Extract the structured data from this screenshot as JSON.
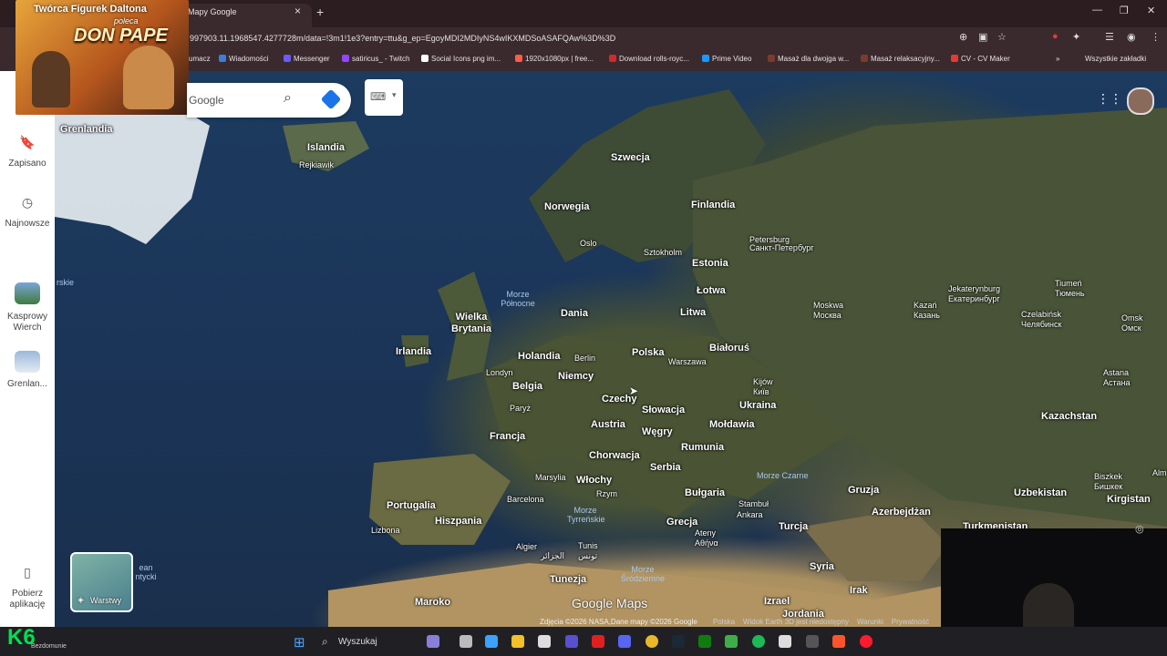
{
  "browser": {
    "tab_title": "Mapy Google",
    "tab_close": "×",
    "new_tab": "+",
    "url": "997903.11.1968547.4277728m/data=!3m1!1e3?entry=ttu&g_ep=EgoyMDI2MDIyNS4wIKXMDSoASAFQAw%3D%3D",
    "window_controls": [
      "—",
      "❐",
      "✕"
    ],
    "address_icons": [
      "zoom-icon",
      "install-icon",
      "star-icon",
      "extension-icon",
      "menu-icon"
    ],
    "bookmarks": [
      {
        "label": "umacz",
        "color": "#3b7ddd"
      },
      {
        "label": "Wiadomości",
        "color": "#3b7ddd"
      },
      {
        "label": "Messenger",
        "color": "#6a5cf5"
      },
      {
        "label": "satiricus_ - Twitch",
        "color": "#9146ff"
      },
      {
        "label": "Social Icons png im...",
        "color": "#ffffff"
      },
      {
        "label": "1920x1080px | free...",
        "color": "#ff5a4a"
      },
      {
        "label": "Download rolls-royc...",
        "color": "#d12a2a"
      },
      {
        "label": "Prime Video",
        "color": "#1a98ff"
      },
      {
        "label": "Masaż dla dwojga w...",
        "color": "#7b3b2f"
      },
      {
        "label": "Masaż relaksacyjny...",
        "color": "#7b3b2f"
      },
      {
        "label": "CV - CV Maker",
        "color": "#e53935"
      }
    ],
    "bookmarks_more": "»",
    "all_bookmarks": "Wszystkie zakładki"
  },
  "promo": {
    "line1": "Twórca Figurek Daltona",
    "line2": "poleca",
    "line3": "DON PAPE"
  },
  "search": {
    "placeholder": "Google"
  },
  "sidebar": {
    "saved": "Zapisano",
    "recent": "Najnowsze",
    "place1": "Kasprowy Wierch",
    "place2": "Grenlan...",
    "get_app": "Pobierz aplikację"
  },
  "map": {
    "countries": [
      {
        "name": "Grenlandia"
      },
      {
        "name": "Islandia"
      },
      {
        "name": "Szwecja"
      },
      {
        "name": "Norwegia"
      },
      {
        "name": "Finlandia"
      },
      {
        "name": "Estonia"
      },
      {
        "name": "Łotwa"
      },
      {
        "name": "Litwa"
      },
      {
        "name": "Dania"
      },
      {
        "name": "Wielka Brytania"
      },
      {
        "name": "Irlandia"
      },
      {
        "name": "Holandia"
      },
      {
        "name": "Polska"
      },
      {
        "name": "Białoruś"
      },
      {
        "name": "Niemcy"
      },
      {
        "name": "Belgia"
      },
      {
        "name": "Czechy"
      },
      {
        "name": "Ukraina"
      },
      {
        "name": "Słowacja"
      },
      {
        "name": "Mołdawia"
      },
      {
        "name": "Austria"
      },
      {
        "name": "Węgry"
      },
      {
        "name": "Francja"
      },
      {
        "name": "Rumunia"
      },
      {
        "name": "Chorwacja"
      },
      {
        "name": "Serbia"
      },
      {
        "name": "Włochy"
      },
      {
        "name": "Bułgaria"
      },
      {
        "name": "Portugalia"
      },
      {
        "name": "Hiszpania"
      },
      {
        "name": "Grecja"
      },
      {
        "name": "Turcja"
      },
      {
        "name": "Gruzja"
      },
      {
        "name": "Azerbejdżan"
      },
      {
        "name": "Kazachstan"
      },
      {
        "name": "Uzbekistan"
      },
      {
        "name": "Kirgistan"
      },
      {
        "name": "Turkmenistan"
      },
      {
        "name": "Tunezja"
      },
      {
        "name": "Maroko"
      },
      {
        "name": "Syria"
      },
      {
        "name": "Irak"
      },
      {
        "name": "Izrael"
      },
      {
        "name": "Jordania"
      }
    ],
    "cities": [
      "Rejkiawik",
      "Oslo",
      "Sztokholm",
      "Petersburg",
      "Санкт-Петербург",
      "Moskwa",
      "Москва",
      "Kazań",
      "Казань",
      "Jekaterynburg",
      "Екатеринбург",
      "Czelabińsk",
      "Челябинск",
      "Tiumeń",
      "Тюмень",
      "Omsk",
      "Омск",
      "Astana",
      "Астана",
      "Londyn",
      "Berlin",
      "Warszawa",
      "Kijów",
      "Київ",
      "Paryż",
      "Marsylia",
      "Rzym",
      "Barcelona",
      "Lizbona",
      "Stambuł",
      "Ankara",
      "Ateny",
      "Αθήνα",
      "Algier",
      "الجزائر",
      "Tunis",
      "تونس",
      "Biszkek",
      "Бишкек",
      "Alm"
    ],
    "seas": [
      "Morze Północne",
      "Morze Czarne",
      "Morze Tyrreńskie",
      "Morze Śródziemne",
      "ean ntycki",
      "rskie"
    ],
    "layers_label": "Warstwy",
    "logo": "Google Maps",
    "attribution": "Zdjęcia ©2026 NASA,Dane mapy ©2026 Google",
    "attribution_more": "Polska    Widok Earth 3D jest niedostępny    Warunki    Prywatność",
    "apps_icon": "apps-grid-icon"
  },
  "taskbar": {
    "search_label": "Wyszukaj",
    "k6_label": "K6",
    "k6_sub": "Bezdomunie"
  }
}
